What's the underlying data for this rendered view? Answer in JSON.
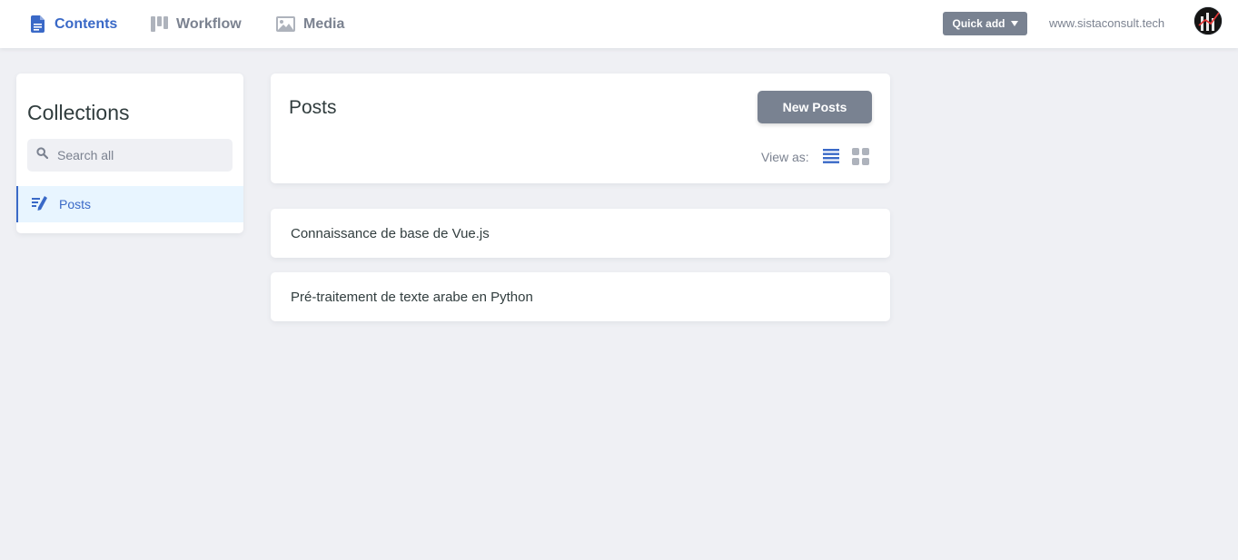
{
  "topbar": {
    "nav": [
      {
        "label": "Contents",
        "icon": "document-icon",
        "active": true
      },
      {
        "label": "Workflow",
        "icon": "workflow-columns-icon",
        "active": false
      },
      {
        "label": "Media",
        "icon": "image-icon",
        "active": false
      }
    ],
    "quick_add_label": "Quick add",
    "site_url": "www.sistaconsult.tech"
  },
  "sidebar": {
    "title": "Collections",
    "search_placeholder": "Search all",
    "items": [
      {
        "label": "Posts",
        "icon": "edit-list-icon",
        "active": true
      }
    ]
  },
  "main": {
    "title": "Posts",
    "new_button_label": "New Posts",
    "view_as_label": "View as:",
    "view_modes": [
      "list-view-icon",
      "grid-view-icon"
    ],
    "entries": [
      {
        "title": "Connaissance de base de Vue.js"
      },
      {
        "title": "Pré-traitement de texte arabe en Python"
      }
    ]
  },
  "colors": {
    "accent": "#3a69c7",
    "muted": "#7b8290",
    "button": "#798291",
    "background": "#eff0f4",
    "active_item_bg": "#e8f5ff"
  }
}
